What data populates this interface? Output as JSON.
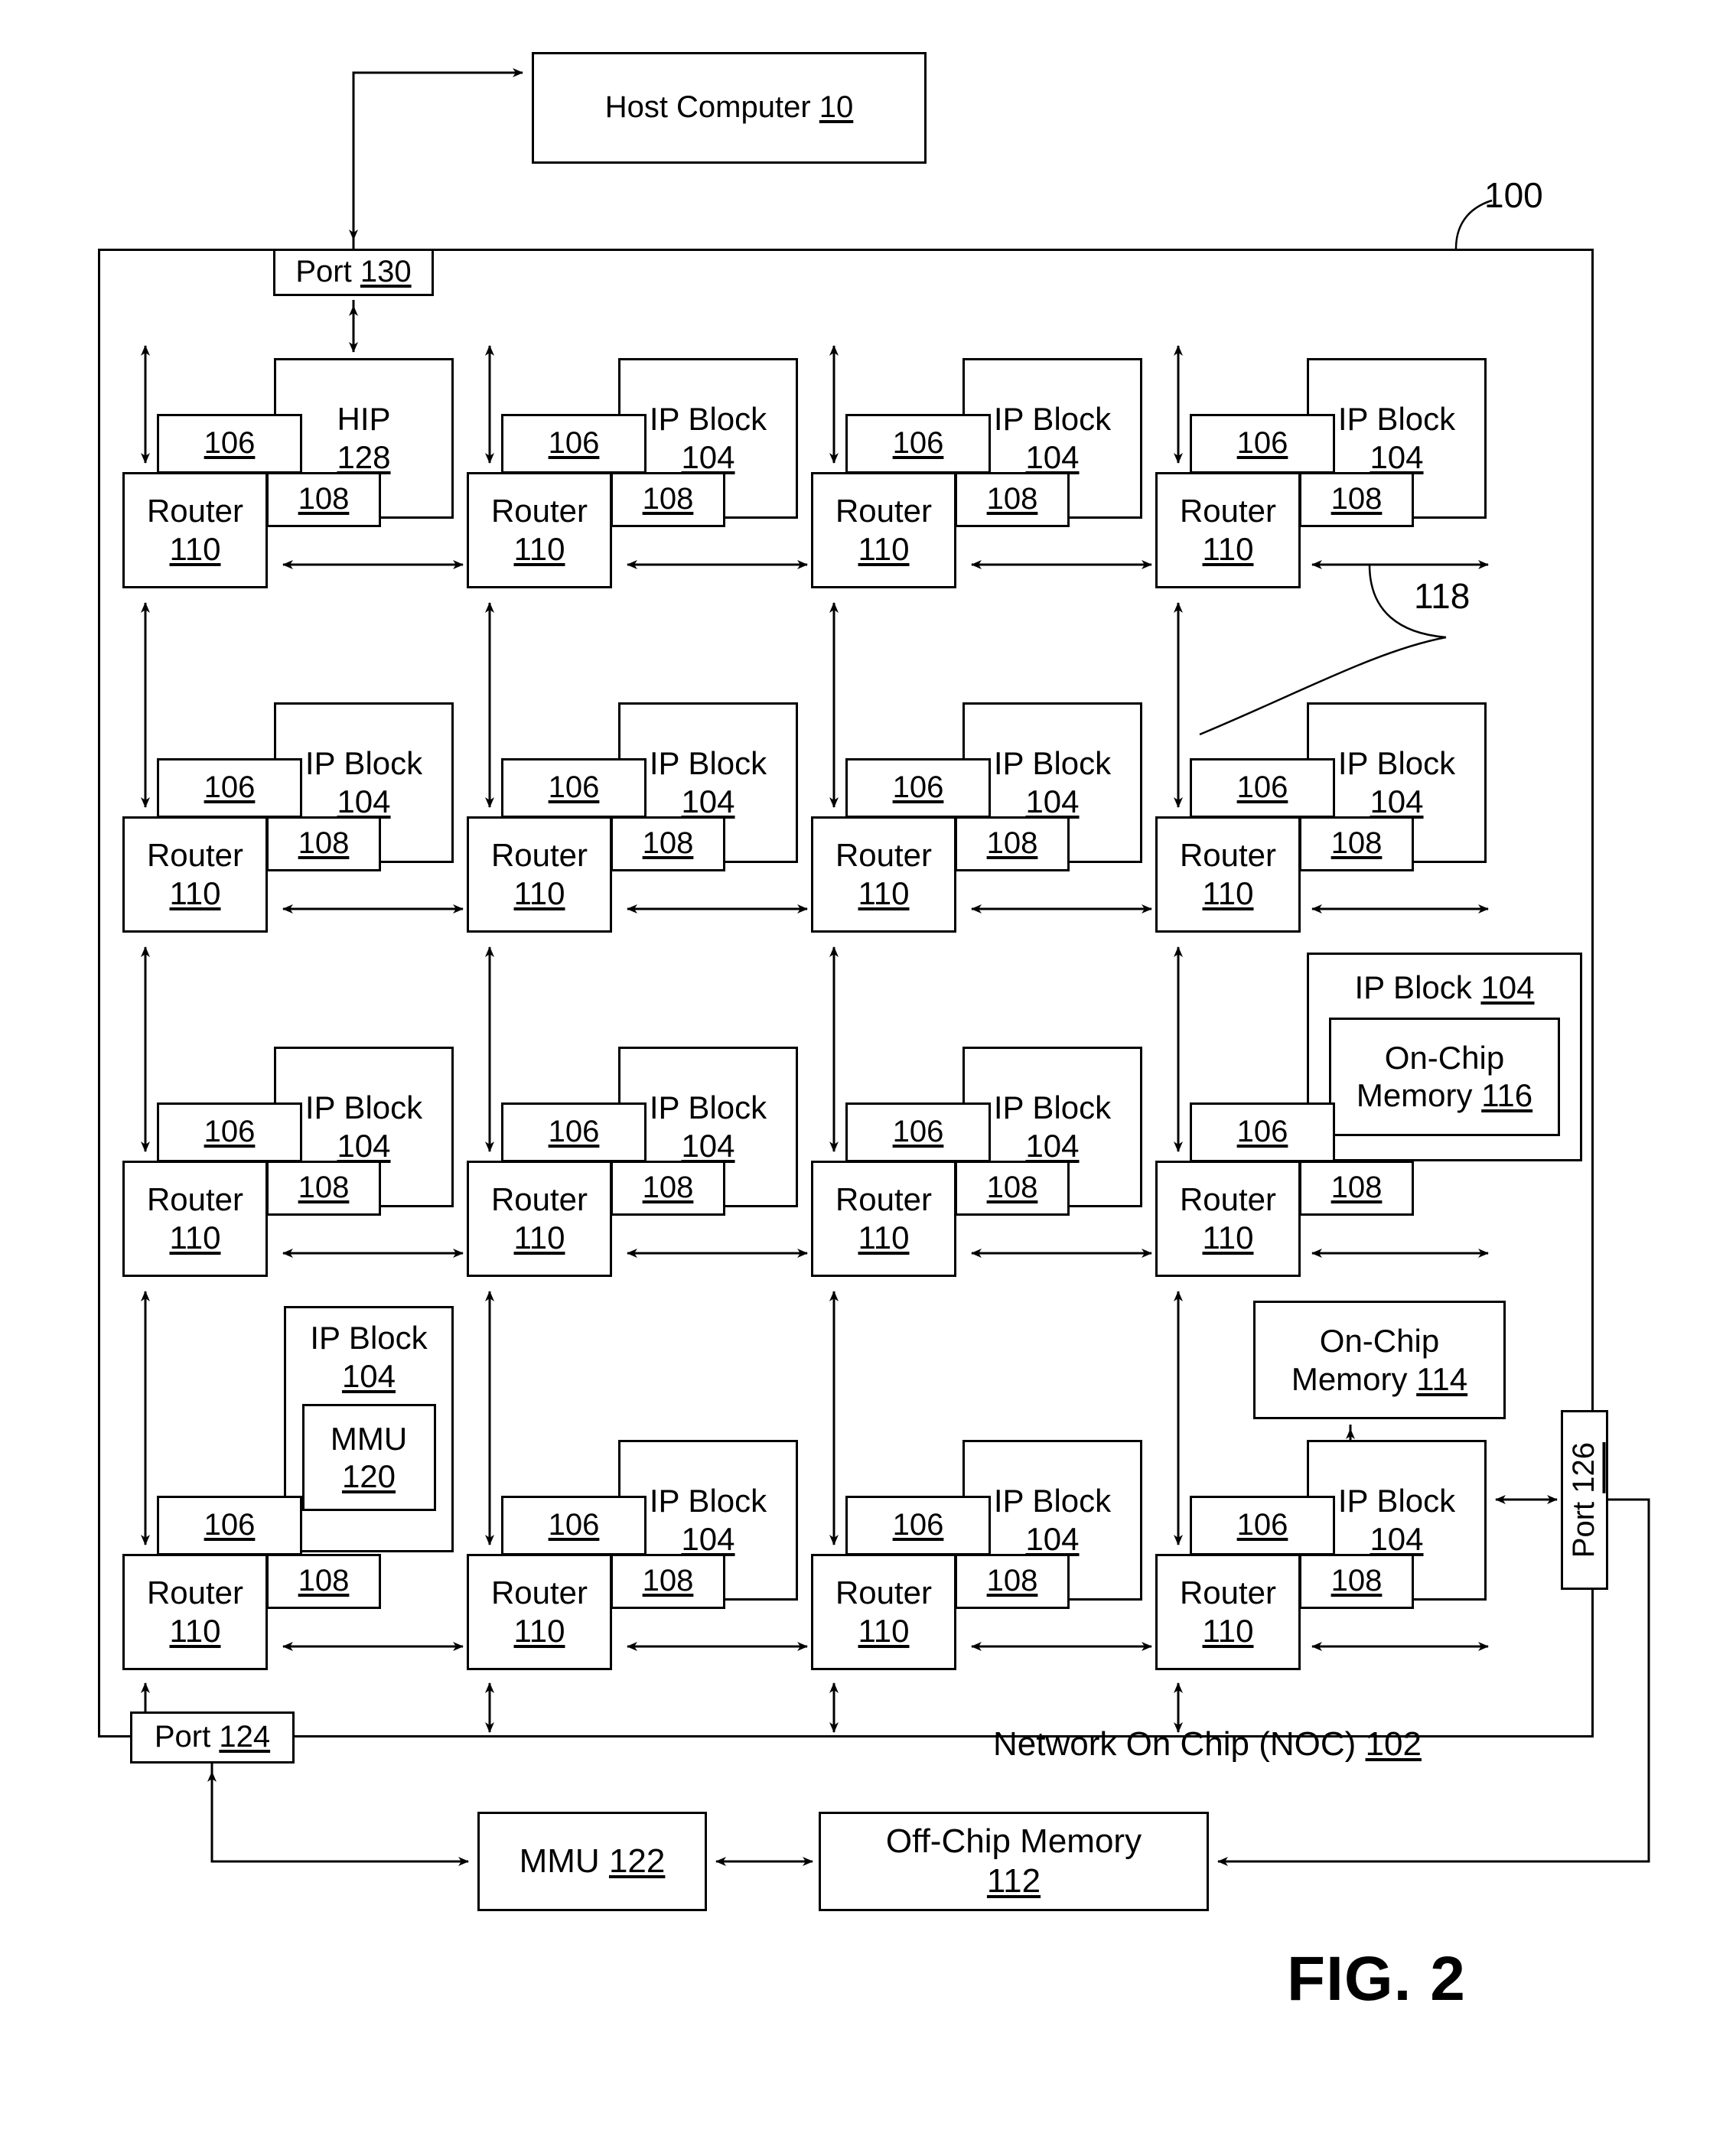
{
  "figure": {
    "caption": "FIG. 2",
    "system_label": "100"
  },
  "host": {
    "label": "Host Computer 10",
    "text": "Host Computer",
    "ref": "10"
  },
  "noc": {
    "label": "Network On Chip (NOC) 102",
    "text": "Network On Chip (NOC)",
    "ref": "102",
    "link_label": "118"
  },
  "ports": {
    "top": {
      "text": "Port",
      "ref": "130"
    },
    "bottom_left": {
      "text": "Port",
      "ref": "124"
    },
    "right": {
      "text": "Port",
      "ref": "126"
    }
  },
  "external": {
    "mmu": {
      "text": "MMU",
      "ref": "122"
    },
    "offchip_memory": {
      "text": "Off-Chip  Memory",
      "ref": "112"
    }
  },
  "cell_refs": {
    "ip_block": "IP Block",
    "ip_block_ref": "104",
    "hip": "HIP",
    "hip_ref": "128",
    "adapter_ref": "106",
    "interface_ref": "108",
    "router": "Router",
    "router_ref": "110"
  },
  "inline_blocks": {
    "mmu120": {
      "text": "MMU",
      "ref": "120"
    },
    "onchip116": {
      "text": "On-Chip Memory",
      "ref": "116"
    },
    "onchip114": {
      "text": "On-Chip Memory",
      "ref": "114"
    }
  },
  "grid": {
    "rows": 4,
    "cols": 4,
    "cells": [
      {
        "row": 0,
        "col": 0,
        "ip_title": "HIP",
        "ip_ref": "128",
        "adapter": "106",
        "iface": "108",
        "router": "Router",
        "router_ref": "110",
        "variant": "hip"
      },
      {
        "row": 0,
        "col": 1,
        "ip_title": "IP Block",
        "ip_ref": "104",
        "adapter": "106",
        "iface": "108",
        "router": "Router",
        "router_ref": "110",
        "variant": "plain"
      },
      {
        "row": 0,
        "col": 2,
        "ip_title": "IP Block",
        "ip_ref": "104",
        "adapter": "106",
        "iface": "108",
        "router": "Router",
        "router_ref": "110",
        "variant": "plain"
      },
      {
        "row": 0,
        "col": 3,
        "ip_title": "IP Block",
        "ip_ref": "104",
        "adapter": "106",
        "iface": "108",
        "router": "Router",
        "router_ref": "110",
        "variant": "plain"
      },
      {
        "row": 1,
        "col": 0,
        "ip_title": "IP Block",
        "ip_ref": "104",
        "adapter": "106",
        "iface": "108",
        "router": "Router",
        "router_ref": "110",
        "variant": "plain"
      },
      {
        "row": 1,
        "col": 1,
        "ip_title": "IP Block",
        "ip_ref": "104",
        "adapter": "106",
        "iface": "108",
        "router": "Router",
        "router_ref": "110",
        "variant": "plain"
      },
      {
        "row": 1,
        "col": 2,
        "ip_title": "IP Block",
        "ip_ref": "104",
        "adapter": "106",
        "iface": "108",
        "router": "Router",
        "router_ref": "110",
        "variant": "plain"
      },
      {
        "row": 1,
        "col": 3,
        "ip_title": "IP Block",
        "ip_ref": "104",
        "adapter": "106",
        "iface": "108",
        "router": "Router",
        "router_ref": "110",
        "variant": "plain"
      },
      {
        "row": 2,
        "col": 0,
        "ip_title": "IP Block",
        "ip_ref": "104",
        "adapter": "106",
        "iface": "108",
        "router": "Router",
        "router_ref": "110",
        "variant": "plain"
      },
      {
        "row": 2,
        "col": 1,
        "ip_title": "IP Block",
        "ip_ref": "104",
        "adapter": "106",
        "iface": "108",
        "router": "Router",
        "router_ref": "110",
        "variant": "plain"
      },
      {
        "row": 2,
        "col": 2,
        "ip_title": "IP Block",
        "ip_ref": "104",
        "adapter": "106",
        "iface": "108",
        "router": "Router",
        "router_ref": "110",
        "variant": "plain"
      },
      {
        "row": 2,
        "col": 3,
        "ip_title": "IP Block 104",
        "ip_ref": "104",
        "adapter": "106",
        "iface": "108",
        "router": "Router",
        "router_ref": "110",
        "variant": "onchip-memory",
        "inner": "On-Chip Memory 116"
      },
      {
        "row": 3,
        "col": 0,
        "ip_title": "IP Block",
        "ip_ref": "104",
        "adapter": "106",
        "iface": "108",
        "router": "Router",
        "router_ref": "110",
        "variant": "mmu",
        "inner": "MMU 120"
      },
      {
        "row": 3,
        "col": 1,
        "ip_title": "IP Block",
        "ip_ref": "104",
        "adapter": "106",
        "iface": "108",
        "router": "Router",
        "router_ref": "110",
        "variant": "plain"
      },
      {
        "row": 3,
        "col": 2,
        "ip_title": "IP Block",
        "ip_ref": "104",
        "adapter": "106",
        "iface": "108",
        "router": "Router",
        "router_ref": "110",
        "variant": "plain"
      },
      {
        "row": 3,
        "col": 3,
        "ip_title": "IP Block",
        "ip_ref": "104",
        "adapter": "106",
        "iface": "108",
        "router": "Router",
        "router_ref": "110",
        "variant": "memory-attached"
      }
    ]
  },
  "colors": {
    "line": "#000000",
    "background": "#ffffff"
  }
}
